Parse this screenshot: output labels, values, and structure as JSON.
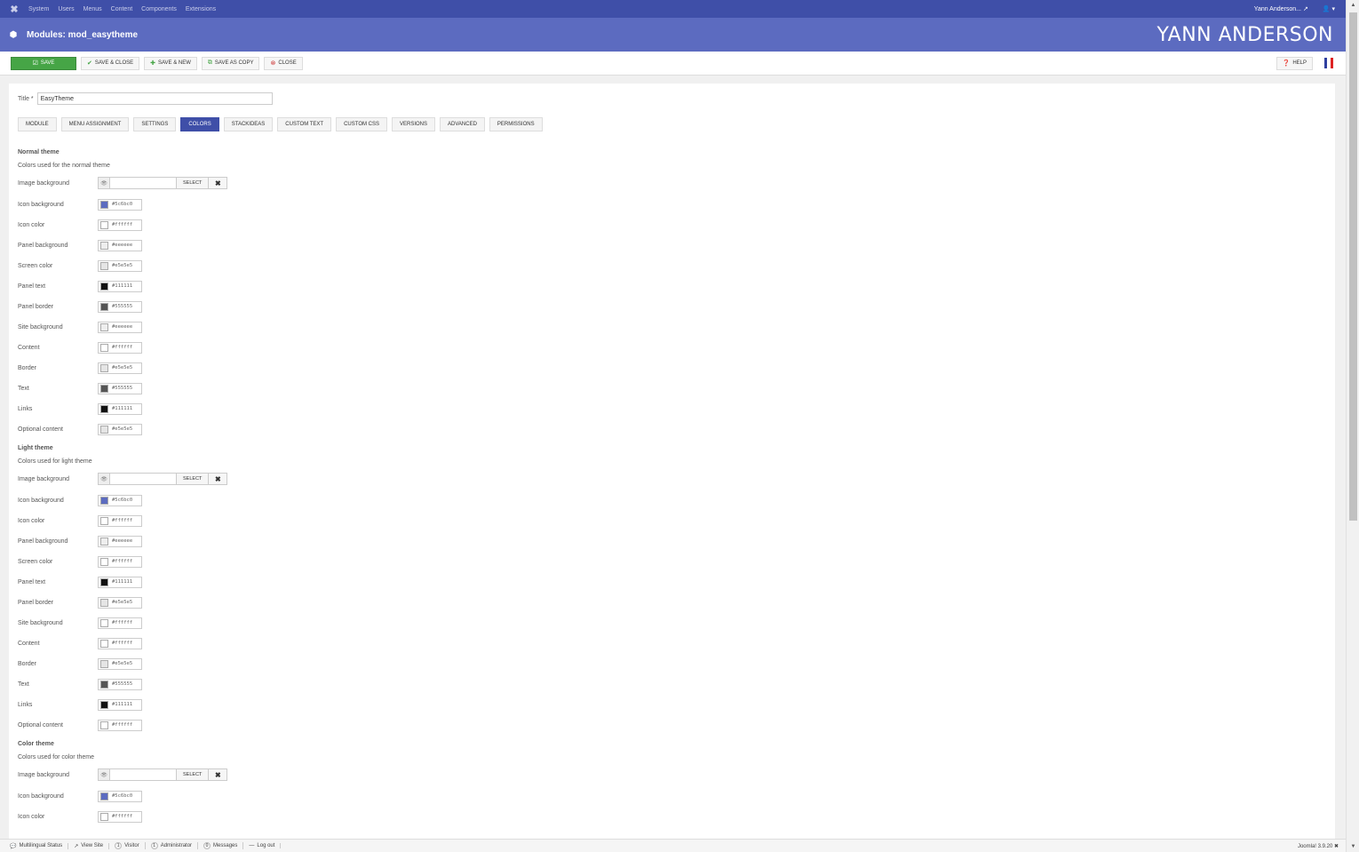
{
  "topnav": {
    "menu": [
      "System",
      "Users",
      "Menus",
      "Content",
      "Components",
      "Extensions"
    ],
    "user_label": "Yann Anderson...",
    "user_icon": "user-icon"
  },
  "header": {
    "title": "Modules: mod_easytheme",
    "brand": "YANN ANDERSON"
  },
  "toolbar": {
    "save": "Save",
    "save_close": "Save & Close",
    "save_new": "Save & New",
    "save_copy": "Save as Copy",
    "close": "Close",
    "help": "Help"
  },
  "form": {
    "title_label": "Title *",
    "title_value": "EasyTheme"
  },
  "tabs": [
    "Module",
    "Menu Assignment",
    "Settings",
    "Colors",
    "Stackideas",
    "Custom Text",
    "Custom CSS",
    "Versions",
    "Advanced",
    "Permissions"
  ],
  "active_tab": "Colors",
  "image_field": {
    "select_label": "Select",
    "clear_label": "✖"
  },
  "sections": [
    {
      "title": "Normal theme",
      "desc": "Colors used for the normal theme",
      "image_label": "Image background",
      "fields": [
        {
          "label": "Icon background",
          "value": "#5c6bc0"
        },
        {
          "label": "Icon color",
          "value": "#ffffff"
        },
        {
          "label": "Panel background",
          "value": "#eeeeee"
        },
        {
          "label": "Screen color",
          "value": "#e5e5e5"
        },
        {
          "label": "Panel text",
          "value": "#111111"
        },
        {
          "label": "Panel border",
          "value": "#555555"
        },
        {
          "label": "Site background",
          "value": "#eeeeee"
        },
        {
          "label": "Content",
          "value": "#ffffff"
        },
        {
          "label": "Border",
          "value": "#e5e5e5"
        },
        {
          "label": "Text",
          "value": "#555555"
        },
        {
          "label": "Links",
          "value": "#111111"
        },
        {
          "label": "Optional content",
          "value": "#e5e5e5"
        }
      ]
    },
    {
      "title": "Light theme",
      "desc": "Colors used for light theme",
      "image_label": "Image background",
      "fields": [
        {
          "label": "Icon background",
          "value": "#5c6bc0"
        },
        {
          "label": "Icon color",
          "value": "#ffffff"
        },
        {
          "label": "Panel background",
          "value": "#eeeeee"
        },
        {
          "label": "Screen color",
          "value": "#ffffff"
        },
        {
          "label": "Panel text",
          "value": "#111111"
        },
        {
          "label": "Panel border",
          "value": "#e5e5e5"
        },
        {
          "label": "Site background",
          "value": "#ffffff"
        },
        {
          "label": "Content",
          "value": "#ffffff"
        },
        {
          "label": "Border",
          "value": "#e5e5e5"
        },
        {
          "label": "Text",
          "value": "#555555"
        },
        {
          "label": "Links",
          "value": "#111111"
        },
        {
          "label": "Optional content",
          "value": "#ffffff"
        }
      ]
    },
    {
      "title": "Color theme",
      "desc": "Colors used for color theme",
      "image_label": "Image background",
      "fields": [
        {
          "label": "Icon background",
          "value": "#5c6bc0"
        },
        {
          "label": "Icon color",
          "value": "#ffffff"
        }
      ]
    }
  ],
  "statusbar": {
    "multilingual": "Multilingual Status",
    "view_site": "View Site",
    "visitor_count": "1",
    "visitor": "Visitor",
    "admin_count": "1",
    "admin": "Administrator",
    "messages_count": "0",
    "messages": "Messages",
    "logout": "Log out",
    "version": "Joomla! 3.9.20"
  },
  "colors": {
    "nav": "#3f4fa8",
    "header": "#5c6bc0",
    "save_green": "#46a546"
  }
}
